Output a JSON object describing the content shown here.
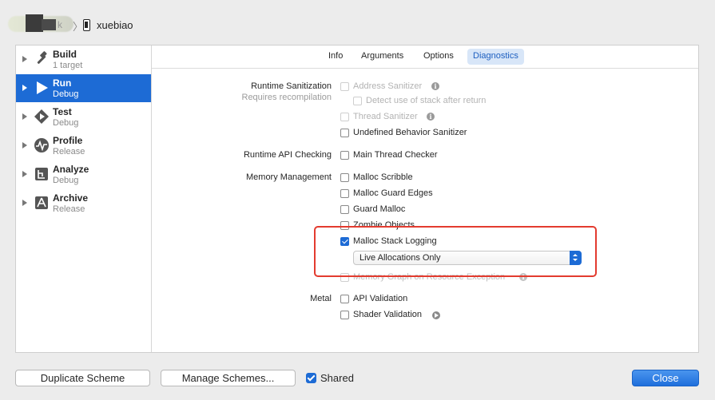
{
  "breadcrumb": {
    "partial_text": "k",
    "target": "xuebiao"
  },
  "sidebar": {
    "items": [
      {
        "label": "Build",
        "sub": "1 target",
        "icon": "hammer-icon"
      },
      {
        "label": "Run",
        "sub": "Debug",
        "icon": "play-icon",
        "selected": true
      },
      {
        "label": "Test",
        "sub": "Debug",
        "icon": "test-diamond-icon"
      },
      {
        "label": "Profile",
        "sub": "Release",
        "icon": "waveform-icon"
      },
      {
        "label": "Analyze",
        "sub": "Debug",
        "icon": "analyze-icon"
      },
      {
        "label": "Archive",
        "sub": "Release",
        "icon": "archive-icon"
      }
    ]
  },
  "tabs": [
    "Info",
    "Arguments",
    "Options",
    "Diagnostics"
  ],
  "active_tab": "Diagnostics",
  "sections": {
    "runtime_sanitization": {
      "label": "Runtime Sanitization",
      "sub": "Requires recompilation",
      "options": {
        "address_sanitizer": "Address Sanitizer",
        "detect_stack": "Detect use of stack after return",
        "thread_sanitizer": "Thread Sanitizer",
        "ub_sanitizer": "Undefined Behavior Sanitizer"
      }
    },
    "runtime_api": {
      "label": "Runtime API Checking",
      "options": {
        "main_thread_checker": "Main Thread Checker"
      }
    },
    "memory": {
      "label": "Memory Management",
      "options": {
        "malloc_scribble": "Malloc Scribble",
        "malloc_guard_edges": "Malloc Guard Edges",
        "guard_malloc": "Guard Malloc",
        "zombie_objects": "Zombie Objects",
        "malloc_stack_logging": "Malloc Stack Logging",
        "stack_logging_mode": "Live Allocations Only",
        "memory_graph": "Memory Graph on Resource Exception"
      }
    },
    "metal": {
      "label": "Metal",
      "options": {
        "api_validation": "API Validation",
        "shader_validation": "Shader Validation"
      }
    }
  },
  "footer": {
    "duplicate": "Duplicate Scheme",
    "manage": "Manage Schemes...",
    "shared": "Shared",
    "close": "Close"
  },
  "colors": {
    "accent": "#1d6bd5",
    "highlight_box": "#e33b2f"
  }
}
